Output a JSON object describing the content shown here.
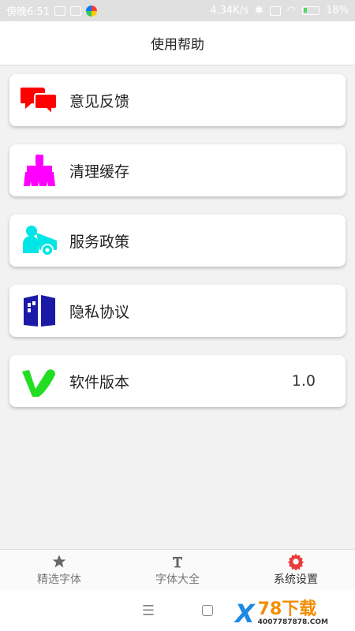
{
  "status_bar": {
    "time": "傍晚6:51",
    "speed": "4.34K/s",
    "battery_percent": "18%"
  },
  "app_bar": {
    "title": "使用帮助"
  },
  "menu": [
    {
      "label": "意见反馈",
      "icon": "chat-bubbles-icon",
      "color": "#ff0000"
    },
    {
      "label": "清理缓存",
      "icon": "broom-icon",
      "color": "#ff00ff"
    },
    {
      "label": "服务政策",
      "icon": "service-person-icon",
      "color": "#00e5e5"
    },
    {
      "label": "隐私协议",
      "icon": "privacy-book-icon",
      "color": "#1a1aa6"
    },
    {
      "label": "软件版本",
      "icon": "version-v-icon",
      "color": "#22dd22",
      "value": "1.0"
    }
  ],
  "bottom_nav": [
    {
      "label": "精选字体",
      "icon": "star-icon",
      "active": false
    },
    {
      "label": "字体大全",
      "icon": "text-t-icon",
      "active": false
    },
    {
      "label": "系统设置",
      "icon": "gear-icon",
      "active": true,
      "color": "#e83b3b"
    }
  ],
  "watermark": {
    "main": "78下载",
    "sub": "4007787878.COM"
  }
}
